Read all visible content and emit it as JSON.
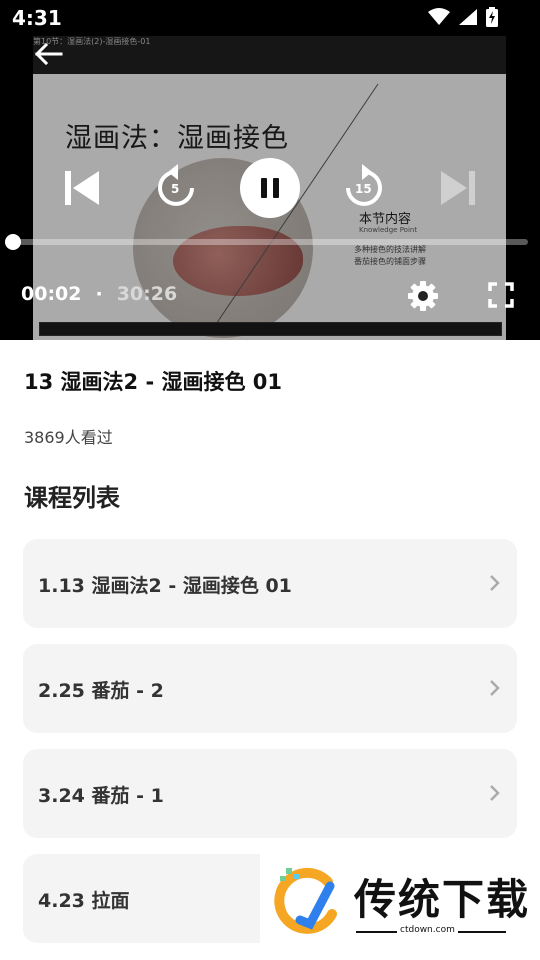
{
  "status_bar": {
    "time": "4:31",
    "icons": [
      "wifi-icon",
      "signal-icon",
      "battery-icon"
    ]
  },
  "player": {
    "slide": {
      "breadcrumb": "第10节：湿画法(2)-湿画接色-01",
      "title": "湿画法：湿画接色",
      "section": "本节内容",
      "section_sub": "Knowledge Point",
      "bullet_1": "多种接色的技法讲解",
      "bullet_2": "番茄接色的铺面步骤"
    },
    "skip_back_seconds": "5",
    "skip_forward_seconds": "15",
    "current_time": "00:02",
    "separator": "·",
    "duration": "30:26",
    "progress": 0.001,
    "colors": {
      "background": "#000000",
      "controls": "#ffffff"
    }
  },
  "video": {
    "title": "13 湿画法2 - 湿画接色 01",
    "views": "3869人看过"
  },
  "course_list": {
    "title": "课程列表",
    "items": [
      {
        "label": "1.13 湿画法2 - 湿画接色 01"
      },
      {
        "label": "2.25 番茄 - 2"
      },
      {
        "label": "3.24 番茄 - 1"
      },
      {
        "label": "4.23 拉面"
      }
    ]
  },
  "watermark": {
    "brand": "传统下载",
    "url": "ctdown.com"
  }
}
